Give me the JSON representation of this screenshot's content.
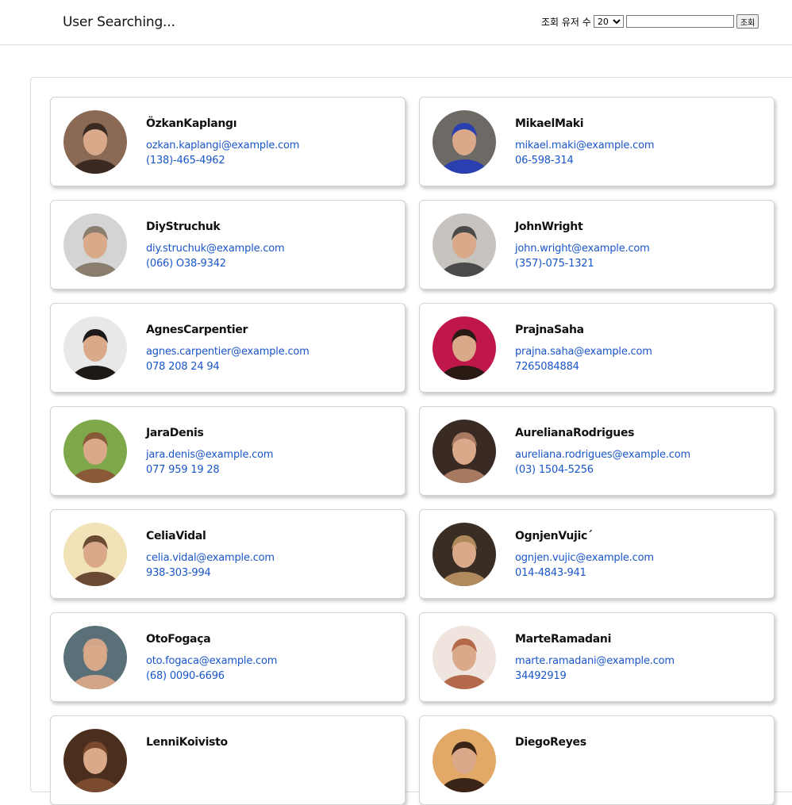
{
  "header": {
    "title": "User Searching...",
    "search_label": "조회 유저 수",
    "count_selected": "20",
    "count_options": [
      "20"
    ],
    "search_value": "",
    "search_button_label": "조회"
  },
  "users": [
    {
      "name": "ÖzkanKaplangı",
      "email": "ozkan.kaplangi@example.com",
      "phone": "(138)-465-4962",
      "avatar_bg": "#8a6a55",
      "avatar_fg": "#3b2a22"
    },
    {
      "name": "MikaelMaki",
      "email": "mikael.maki@example.com",
      "phone": "06-598-314",
      "avatar_bg": "#6d6a66",
      "avatar_fg": "#2a3fb0"
    },
    {
      "name": "DiyStruchuk",
      "email": "diy.struchuk@example.com",
      "phone": "(066) O38-9342",
      "avatar_bg": "#d4d4d4",
      "avatar_fg": "#8a7d6e"
    },
    {
      "name": "JohnWright",
      "email": "john.wright@example.com",
      "phone": "(357)-075-1321",
      "avatar_bg": "#c7c4c0",
      "avatar_fg": "#4a4a4a"
    },
    {
      "name": "AgnesCarpentier",
      "email": "agnes.carpentier@example.com",
      "phone": "078 208 24 94",
      "avatar_bg": "#e8e8e8",
      "avatar_fg": "#1e1a18"
    },
    {
      "name": "PrajnaSaha",
      "email": "prajna.saha@example.com",
      "phone": "7265084884",
      "avatar_bg": "#c0174a",
      "avatar_fg": "#2a1a14"
    },
    {
      "name": "JaraDenis",
      "email": "jara.denis@example.com",
      "phone": "077 959 19 28",
      "avatar_bg": "#7ea84a",
      "avatar_fg": "#8a5a38"
    },
    {
      "name": "AurelianaRodrigues",
      "email": "aureliana.rodrigues@example.com",
      "phone": "(03) 1504-5256",
      "avatar_bg": "#3a2a24",
      "avatar_fg": "#a87a62"
    },
    {
      "name": "CeliaVidal",
      "email": "celia.vidal@example.com",
      "phone": "938-303-994",
      "avatar_bg": "#f2e2b8",
      "avatar_fg": "#6a4a34"
    },
    {
      "name": "OgnjenVujic´",
      "email": "ognjen.vujic@example.com",
      "phone": "014-4843-941",
      "avatar_bg": "#3a2e24",
      "avatar_fg": "#b08a5c"
    },
    {
      "name": "OtoFogaça",
      "email": "oto.fogaca@example.com",
      "phone": "(68) 0090-6696",
      "avatar_bg": "#5a7078",
      "avatar_fg": "#d2a488"
    },
    {
      "name": "MarteRamadani",
      "email": "marte.ramadani@example.com",
      "phone": "34492919",
      "avatar_bg": "#f0e4de",
      "avatar_fg": "#b46a4a"
    },
    {
      "name": "LenniKoivisto",
      "email": "",
      "phone": "",
      "avatar_bg": "#4a2e1e",
      "avatar_fg": "#7a4a2e"
    },
    {
      "name": "DiegoReyes",
      "email": "",
      "phone": "",
      "avatar_bg": "#e2a868",
      "avatar_fg": "#3a2418"
    }
  ]
}
